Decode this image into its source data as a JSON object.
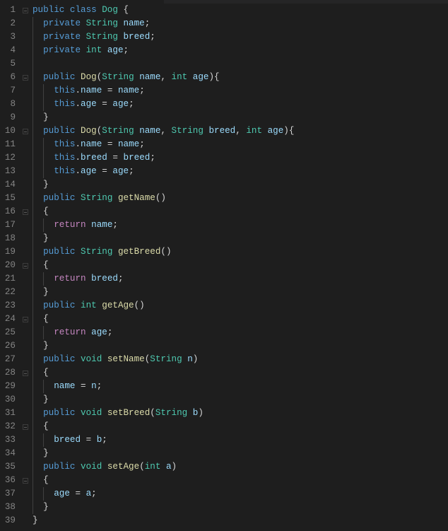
{
  "editor": {
    "fold_lines": [
      1,
      6,
      10,
      16,
      20,
      24,
      28,
      32,
      36
    ],
    "lines": [
      [
        [
          "k",
          "public class "
        ],
        [
          "t",
          "Dog"
        ],
        [
          "p",
          " {"
        ]
      ],
      [
        [
          "p",
          "  "
        ],
        [
          "k",
          "private "
        ],
        [
          "t",
          "String "
        ],
        [
          "v",
          "name"
        ],
        [
          "p",
          ";"
        ]
      ],
      [
        [
          "p",
          "  "
        ],
        [
          "k",
          "private "
        ],
        [
          "t",
          "String "
        ],
        [
          "v",
          "breed"
        ],
        [
          "p",
          ";"
        ]
      ],
      [
        [
          "p",
          "  "
        ],
        [
          "k",
          "private "
        ],
        [
          "t",
          "int "
        ],
        [
          "v",
          "age"
        ],
        [
          "p",
          ";"
        ]
      ],
      [],
      [
        [
          "p",
          "  "
        ],
        [
          "k",
          "public "
        ],
        [
          "f",
          "Dog"
        ],
        [
          "p",
          "("
        ],
        [
          "t",
          "String "
        ],
        [
          "v",
          "name"
        ],
        [
          "p",
          ", "
        ],
        [
          "t",
          "int "
        ],
        [
          "v",
          "age"
        ],
        [
          "p",
          "){"
        ]
      ],
      [
        [
          "p",
          "    "
        ],
        [
          "k",
          "this"
        ],
        [
          "p",
          "."
        ],
        [
          "v",
          "name"
        ],
        [
          "p",
          " = "
        ],
        [
          "v",
          "name"
        ],
        [
          "p",
          ";"
        ]
      ],
      [
        [
          "p",
          "    "
        ],
        [
          "k",
          "this"
        ],
        [
          "p",
          "."
        ],
        [
          "v",
          "age"
        ],
        [
          "p",
          " = "
        ],
        [
          "v",
          "age"
        ],
        [
          "p",
          ";"
        ]
      ],
      [
        [
          "p",
          "  }"
        ]
      ],
      [
        [
          "p",
          "  "
        ],
        [
          "k",
          "public "
        ],
        [
          "f",
          "Dog"
        ],
        [
          "p",
          "("
        ],
        [
          "t",
          "String "
        ],
        [
          "v",
          "name"
        ],
        [
          "p",
          ", "
        ],
        [
          "t",
          "String "
        ],
        [
          "v",
          "breed"
        ],
        [
          "p",
          ", "
        ],
        [
          "t",
          "int "
        ],
        [
          "v",
          "age"
        ],
        [
          "p",
          "){"
        ]
      ],
      [
        [
          "p",
          "    "
        ],
        [
          "k",
          "this"
        ],
        [
          "p",
          "."
        ],
        [
          "v",
          "name"
        ],
        [
          "p",
          " = "
        ],
        [
          "v",
          "name"
        ],
        [
          "p",
          ";"
        ]
      ],
      [
        [
          "p",
          "    "
        ],
        [
          "k",
          "this"
        ],
        [
          "p",
          "."
        ],
        [
          "v",
          "breed"
        ],
        [
          "p",
          " = "
        ],
        [
          "v",
          "breed"
        ],
        [
          "p",
          ";"
        ]
      ],
      [
        [
          "p",
          "    "
        ],
        [
          "k",
          "this"
        ],
        [
          "p",
          "."
        ],
        [
          "v",
          "age"
        ],
        [
          "p",
          " = "
        ],
        [
          "v",
          "age"
        ],
        [
          "p",
          ";"
        ]
      ],
      [
        [
          "p",
          "  }"
        ]
      ],
      [
        [
          "p",
          "  "
        ],
        [
          "k",
          "public "
        ],
        [
          "t",
          "String "
        ],
        [
          "f",
          "getName"
        ],
        [
          "p",
          "()"
        ]
      ],
      [
        [
          "p",
          "  {"
        ]
      ],
      [
        [
          "p",
          "    "
        ],
        [
          "c",
          "return "
        ],
        [
          "v",
          "name"
        ],
        [
          "p",
          ";"
        ]
      ],
      [
        [
          "p",
          "  }"
        ]
      ],
      [
        [
          "p",
          "  "
        ],
        [
          "k",
          "public "
        ],
        [
          "t",
          "String "
        ],
        [
          "f",
          "getBreed"
        ],
        [
          "p",
          "()"
        ]
      ],
      [
        [
          "p",
          "  {"
        ]
      ],
      [
        [
          "p",
          "    "
        ],
        [
          "c",
          "return "
        ],
        [
          "v",
          "breed"
        ],
        [
          "p",
          ";"
        ]
      ],
      [
        [
          "p",
          "  }"
        ]
      ],
      [
        [
          "p",
          "  "
        ],
        [
          "k",
          "public "
        ],
        [
          "t",
          "int "
        ],
        [
          "f",
          "getAge"
        ],
        [
          "p",
          "()"
        ]
      ],
      [
        [
          "p",
          "  {"
        ]
      ],
      [
        [
          "p",
          "    "
        ],
        [
          "c",
          "return "
        ],
        [
          "v",
          "age"
        ],
        [
          "p",
          ";"
        ]
      ],
      [
        [
          "p",
          "  }"
        ]
      ],
      [
        [
          "p",
          "  "
        ],
        [
          "k",
          "public "
        ],
        [
          "t",
          "void "
        ],
        [
          "f",
          "setName"
        ],
        [
          "p",
          "("
        ],
        [
          "t",
          "String "
        ],
        [
          "v",
          "n"
        ],
        [
          "p",
          ")"
        ]
      ],
      [
        [
          "p",
          "  {"
        ]
      ],
      [
        [
          "p",
          "    "
        ],
        [
          "v",
          "name"
        ],
        [
          "p",
          " = "
        ],
        [
          "v",
          "n"
        ],
        [
          "p",
          ";"
        ]
      ],
      [
        [
          "p",
          "  }"
        ]
      ],
      [
        [
          "p",
          "  "
        ],
        [
          "k",
          "public "
        ],
        [
          "t",
          "void "
        ],
        [
          "f",
          "setBreed"
        ],
        [
          "p",
          "("
        ],
        [
          "t",
          "String "
        ],
        [
          "v",
          "b"
        ],
        [
          "p",
          ")"
        ]
      ],
      [
        [
          "p",
          "  {"
        ]
      ],
      [
        [
          "p",
          "    "
        ],
        [
          "v",
          "breed"
        ],
        [
          "p",
          " = "
        ],
        [
          "v",
          "b"
        ],
        [
          "p",
          ";"
        ]
      ],
      [
        [
          "p",
          "  }"
        ]
      ],
      [
        [
          "p",
          "  "
        ],
        [
          "k",
          "public "
        ],
        [
          "t",
          "void "
        ],
        [
          "f",
          "setAge"
        ],
        [
          "p",
          "("
        ],
        [
          "t",
          "int "
        ],
        [
          "v",
          "a"
        ],
        [
          "p",
          ")"
        ]
      ],
      [
        [
          "p",
          "  {"
        ]
      ],
      [
        [
          "p",
          "    "
        ],
        [
          "v",
          "age"
        ],
        [
          "p",
          " = "
        ],
        [
          "v",
          "a"
        ],
        [
          "p",
          ";"
        ]
      ],
      [
        [
          "p",
          "  }"
        ]
      ],
      [
        [
          "p",
          "}"
        ]
      ]
    ],
    "line_numbers": [
      "1",
      "2",
      "3",
      "4",
      "5",
      "6",
      "7",
      "8",
      "9",
      "10",
      "11",
      "12",
      "13",
      "14",
      "15",
      "16",
      "17",
      "18",
      "19",
      "20",
      "21",
      "22",
      "23",
      "24",
      "25",
      "26",
      "27",
      "28",
      "29",
      "30",
      "31",
      "32",
      "33",
      "34",
      "35",
      "36",
      "37",
      "38",
      "39"
    ]
  }
}
